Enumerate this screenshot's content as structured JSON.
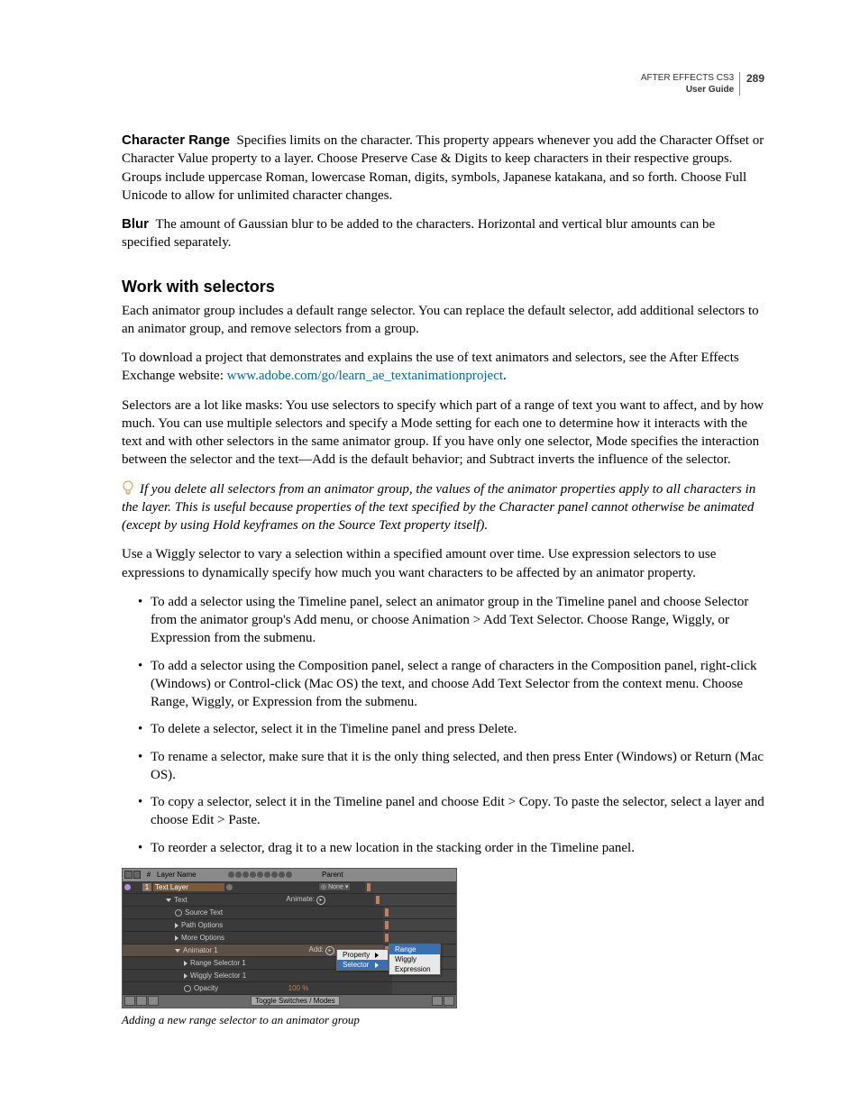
{
  "header": {
    "product": "AFTER EFFECTS CS3",
    "guide": "User Guide",
    "page_number": "289"
  },
  "defs": {
    "char_range_term": "Character Range",
    "char_range_body": "Specifies limits on the character. This property appears whenever you add the Character Offset or Character Value property to a layer. Choose Preserve Case & Digits to keep characters in their respective groups. Groups include uppercase Roman, lowercase Roman, digits, symbols, Japanese katakana, and so forth. Choose Full Unicode to allow for unlimited character changes.",
    "blur_term": "Blur",
    "blur_body": "The amount of Gaussian blur to be added to the characters. Horizontal and vertical blur amounts can be specified separately."
  },
  "heading": "Work with selectors",
  "para1": "Each animator group includes a default range selector. You can replace the default selector, add additional selectors to an animator group, and remove selectors from a group.",
  "para2a": "To download a project that demonstrates and explains the use of text animators and selectors, see the After Effects Exchange website: ",
  "link_text": "www.adobe.com/go/learn_ae_textanimationproject",
  "para2b": ".",
  "para3": "Selectors are a lot like masks: You use selectors to specify which part of a range of text you want to affect, and by how much. You can use multiple selectors and specify a Mode setting for each one to determine how it interacts with the text and with other selectors in the same animator group. If you have only one selector, Mode specifies the interaction between the selector and the text—Add is the default behavior; and Subtract inverts the influence of the selector.",
  "tip": "If you delete all selectors from an animator group, the values of the animator properties apply to all characters in the layer. This is useful because properties of the text specified by the Character panel cannot otherwise be animated (except by using Hold keyframes on the Source Text property itself).",
  "para4": "Use a Wiggly selector to vary a selection within a specified amount over time. Use expression selectors to use expressions to dynamically specify how much you want characters to be affected by an animator property.",
  "bullets": [
    "To add a selector using the Timeline panel, select an animator group in the Timeline panel and choose Selector from the animator group's Add menu, or choose Animation > Add Text Selector. Choose Range, Wiggly, or Expression from the submenu.",
    "To add a selector using the Composition panel, select a range of characters in the Composition panel, right-click (Windows) or Control-click (Mac OS) the text, and choose Add Text Selector from the context menu. Choose Range, Wiggly, or Expression from the submenu.",
    "To delete a selector, select it in the Timeline panel and press Delete.",
    "To rename a selector, make sure that it is the only thing selected, and then press Enter (Windows) or Return (Mac OS).",
    "To copy a selector, select it in the Timeline panel and choose Edit > Copy. To paste the selector, select a layer and choose Edit > Paste.",
    "To reorder a selector, drag it to a new location in the stacking order in the Timeline panel."
  ],
  "timeline": {
    "col_num": "#",
    "col_name": "Layer Name",
    "col_parent": "Parent",
    "layer_num": "1",
    "layer_name": "Text Layer",
    "parent_none": "None",
    "text_row": "Text",
    "animate_label": "Animate:",
    "source_text": "Source Text",
    "path_options": "Path Options",
    "more_options": "More Options",
    "animator1": "Animator 1",
    "add_label": "Add:",
    "range_sel": "Range Selector 1",
    "wiggly_sel": "Wiggly Selector 1",
    "opacity": "Opacity",
    "opacity_val": "100 %",
    "toggle": "Toggle Switches / Modes",
    "flyout1": {
      "property": "Property",
      "selector": "Selector"
    },
    "flyout2": {
      "range": "Range",
      "wiggly": "Wiggly",
      "expression": "Expression"
    }
  },
  "caption": "Adding a new range selector to an animator group"
}
